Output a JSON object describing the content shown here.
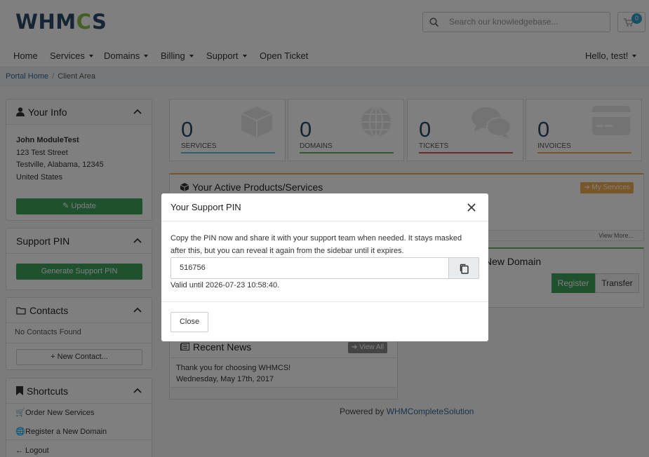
{
  "header": {
    "logo": {
      "text_a": "WHM",
      "text_b": "C",
      "text_c": "S"
    },
    "search_placeholder": "Search our knowledgebase...",
    "cart_count": "0"
  },
  "nav": {
    "items": [
      "Home",
      "Services",
      "Domains",
      "Billing",
      "Support",
      "Open Ticket"
    ],
    "user": "Hello, test!"
  },
  "breadcrumb": {
    "home": "Portal Home",
    "current": "Client Area"
  },
  "your_info": {
    "title": "Your Info",
    "name": "John ModuleTest",
    "address1": "123 Test Street",
    "address2": "Testville, Alabama, 12345",
    "country": "United States",
    "update_label": "Update"
  },
  "support_pin_panel": {
    "title": "Support PIN",
    "button": "Generate Support PIN"
  },
  "contacts": {
    "title": "Contacts",
    "empty": "No Contacts Found",
    "new_contact": "New Contact..."
  },
  "shortcuts": {
    "title": "Shortcuts",
    "items": [
      "Order New Services",
      "Register a New Domain",
      "Logout"
    ]
  },
  "stats": [
    {
      "value": "0",
      "label": "SERVICES",
      "color": "#5bc0de"
    },
    {
      "value": "0",
      "label": "DOMAINS",
      "color": "#5cb85c"
    },
    {
      "value": "0",
      "label": "TICKETS",
      "color": "#d9534f"
    },
    {
      "value": "0",
      "label": "INVOICES",
      "color": "#f0ad4e"
    }
  ],
  "products": {
    "title": "Your Active Products/Services",
    "button": "My Services",
    "view_more": "View More..."
  },
  "domain": {
    "title": "New Domain",
    "register": "Register",
    "transfer": "Transfer"
  },
  "news": {
    "title": "Recent News",
    "view_all": "View All",
    "headline": "Thank you for choosing WHMCS!",
    "date": "Wednesday, May 17th, 2017"
  },
  "footer": {
    "prefix": "Powered by",
    "link": "WHMCompleteSolution"
  },
  "modal": {
    "title": "Your Support PIN",
    "text": "Copy the PIN now and share it with your support team when needed. It stays masked after this, but you can reveal it again from the sidebar until it expires.",
    "pin": "516756",
    "valid": "Valid until 2026-07-23 10:58:40.",
    "close_label": "Close"
  },
  "colors": {
    "brand": "#2c4a66",
    "green": "#41a25f",
    "orange": "#f0ad4e",
    "accent": "#2ea1c8"
  }
}
